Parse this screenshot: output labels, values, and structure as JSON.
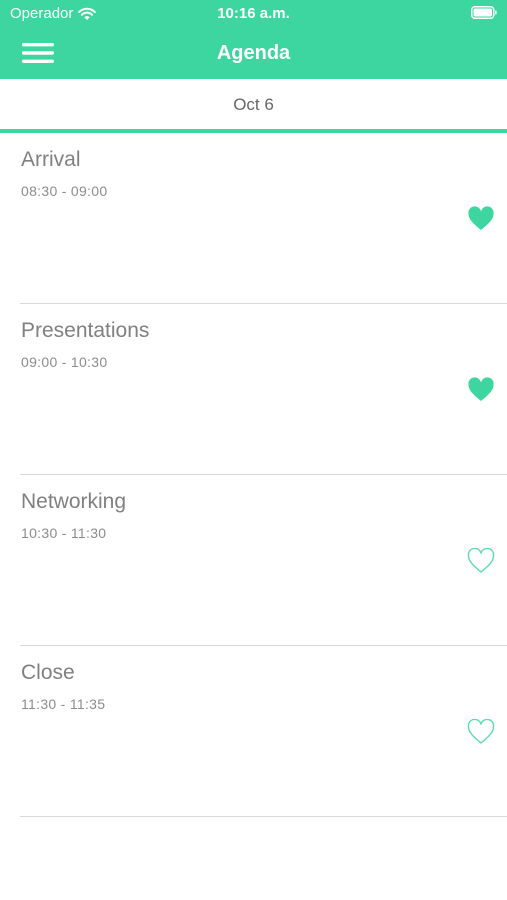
{
  "status_bar": {
    "carrier": "Operador",
    "time": "10:16 a.m."
  },
  "nav": {
    "title": "Agenda"
  },
  "date_tab": {
    "label": "Oct 6"
  },
  "colors": {
    "accent": "#3dd6a0"
  },
  "agenda": [
    {
      "title": "Arrival",
      "time": "08:30 - 09:00",
      "favorited": true
    },
    {
      "title": "Presentations",
      "time": "09:00 - 10:30",
      "favorited": true
    },
    {
      "title": "Networking",
      "time": "10:30 - 11:30",
      "favorited": false
    },
    {
      "title": "Close",
      "time": "11:30 - 11:35",
      "favorited": false
    }
  ]
}
